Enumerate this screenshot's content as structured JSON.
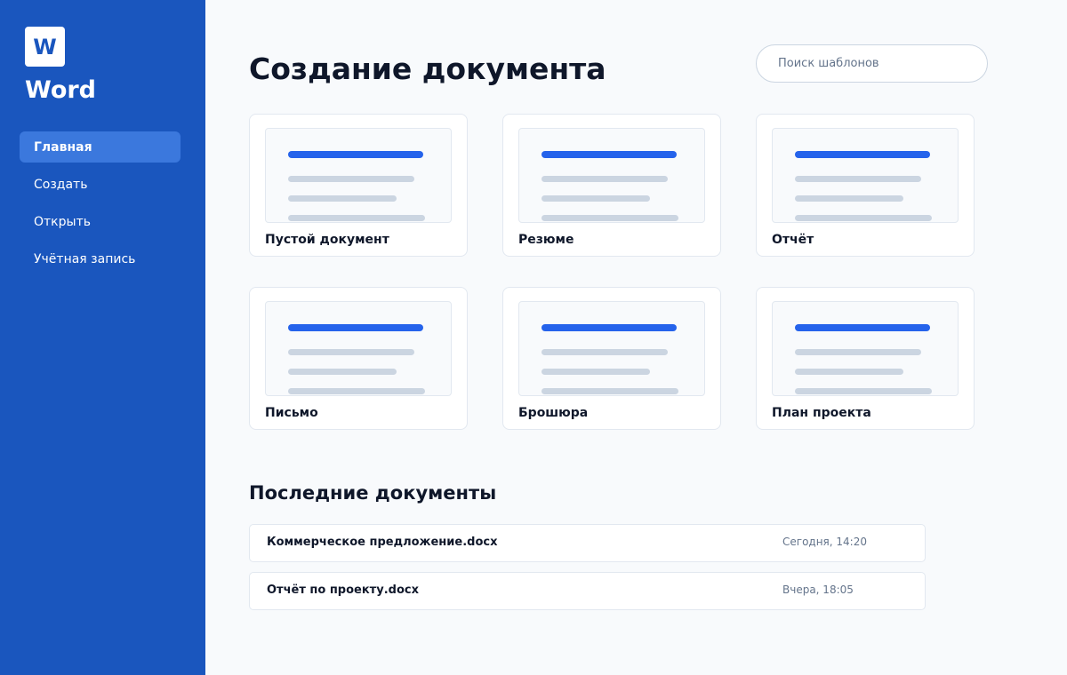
{
  "app": {
    "logo_letter": "W",
    "name": "Word",
    "brand_color": "#1a56be",
    "accent_color": "#2563eb"
  },
  "sidebar": {
    "items": [
      {
        "label": "Главная",
        "active": true
      },
      {
        "label": "Создать",
        "active": false
      },
      {
        "label": "Открыть",
        "active": false
      },
      {
        "label": "Учётная запись",
        "active": false
      }
    ]
  },
  "main": {
    "title": "Создание документа",
    "search": {
      "placeholder": "Поиск шаблонов",
      "value": ""
    },
    "templates": [
      {
        "label": "Пустой документ"
      },
      {
        "label": "Резюме"
      },
      {
        "label": "Отчёт"
      },
      {
        "label": "Письмо"
      },
      {
        "label": "Брошюра"
      },
      {
        "label": "План проекта"
      }
    ],
    "recent": {
      "title": "Последние документы",
      "items": [
        {
          "name": "Коммерческое предложение.docx",
          "time": "Сегодня, 14:20"
        },
        {
          "name": "Отчёт по проекту.docx",
          "time": "Вчера, 18:05"
        }
      ]
    }
  }
}
